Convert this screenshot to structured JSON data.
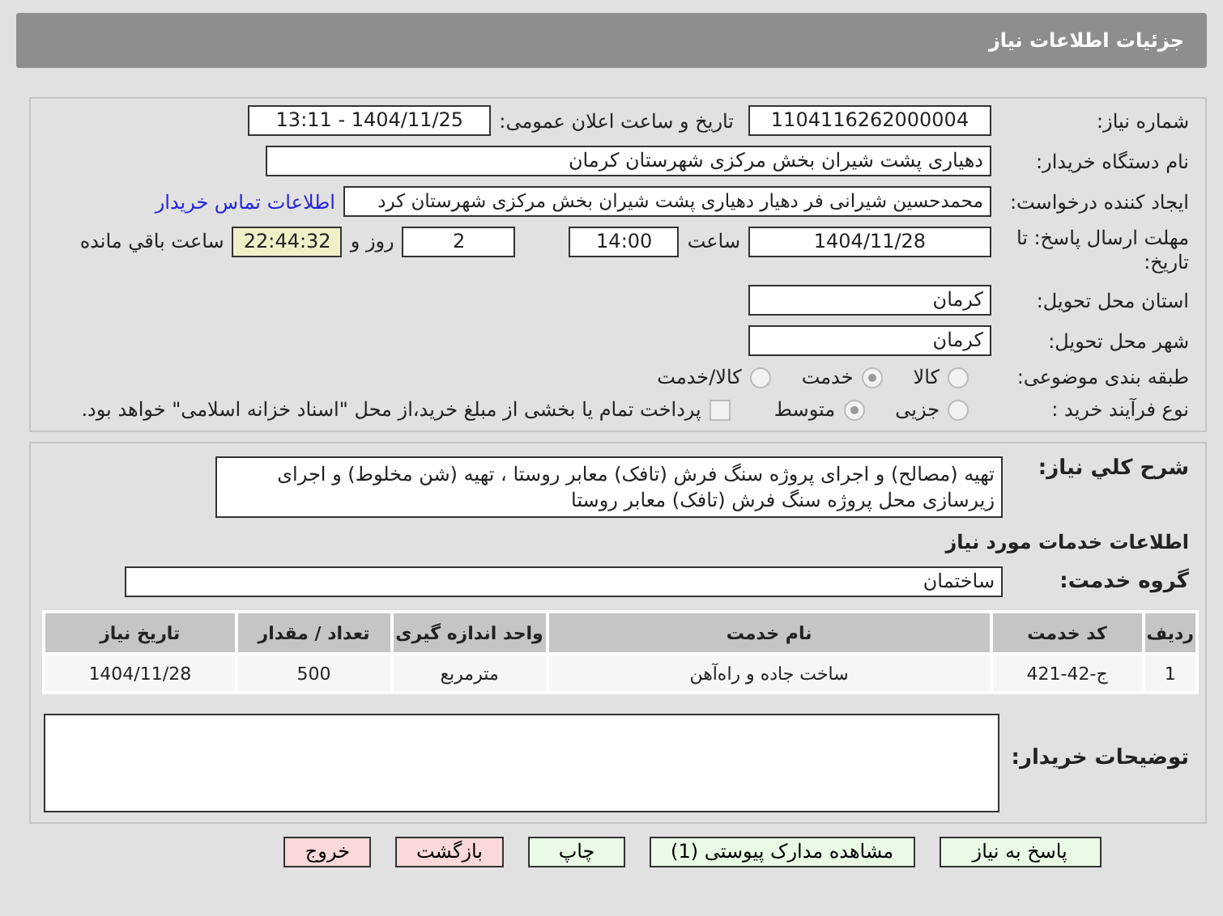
{
  "header": {
    "title": "جزئیات اطلاعات نیاز"
  },
  "details": {
    "need_number": {
      "label": "شماره نیاز:",
      "value": "1104116262000004"
    },
    "announce": {
      "label": "تاریخ و ساعت اعلان عمومی:",
      "value": "1404/11/25 - 13:11"
    },
    "buyer": {
      "label": "نام دستگاه خریدار:",
      "value": "دهیاری پشت شیران بخش مرکزی شهرستان کرمان"
    },
    "creator": {
      "label": "ایجاد کننده درخواست:",
      "value": "محمدحسین شیرانی فر دهیار دهیاری پشت شیران بخش مرکزی شهرستان کرد",
      "link": "اطلاعات تماس خریدار"
    },
    "deadline": {
      "label": "مهلت ارسال پاسخ: تا تاریخ:",
      "date": "1404/11/28",
      "time_label": "ساعت",
      "time": "14:00",
      "days": "2",
      "days_label": "روز و",
      "remaining": "22:44:32",
      "remaining_label": "ساعت باقي مانده"
    },
    "province": {
      "label": "استان محل تحویل:",
      "value": "کرمان"
    },
    "city": {
      "label": "شهر محل تحویل:",
      "value": "کرمان"
    },
    "category": {
      "label": "طبقه بندی موضوعی:",
      "options": [
        {
          "label": "کالا",
          "selected": false
        },
        {
          "label": "خدمت",
          "selected": true
        },
        {
          "label": "کالا/خدمت",
          "selected": false
        }
      ]
    },
    "process": {
      "label": "نوع فرآیند خرید :",
      "options": [
        {
          "label": "جزیی",
          "selected": false
        },
        {
          "label": "متوسط",
          "selected": true
        }
      ],
      "checkbox": {
        "checked": false,
        "label": "پرداخت تمام یا بخشی از مبلغ خرید،از محل \"اسناد خزانه اسلامی\" خواهد بود."
      }
    }
  },
  "description": {
    "label": "شرح کلي نياز:",
    "value": "تهیه (مصالح) و اجرای پروژه سنگ فرش (تافک) معابر روستا ، تهیه (شن مخلوط) و اجرای زیرسازی محل پروژه سنگ فرش (تافک) معابر روستا"
  },
  "services_title": "اطلاعات خدمات مورد نیاز",
  "service_group": {
    "label": "گروه خدمت:",
    "value": "ساختمان"
  },
  "table": {
    "columns": [
      "ردیف",
      "کد خدمت",
      "نام خدمت",
      "واحد اندازه گیری",
      "تعداد / مقدار",
      "تاریخ نیاز"
    ],
    "rows": [
      [
        "1",
        "ج-42-421",
        "ساخت جاده و راه‌آهن",
        "مترمربع",
        "500",
        "1404/11/28"
      ]
    ]
  },
  "buyer_notes": {
    "label": "توضیحات خریدار:"
  },
  "buttons": [
    {
      "label": "پاسخ به نیاز",
      "kind": "normal"
    },
    {
      "label": "مشاهده مدارک پیوستی (1)",
      "kind": "normal"
    },
    {
      "label": "چاپ",
      "kind": "normal"
    },
    {
      "label": "بازگشت",
      "kind": "exit"
    },
    {
      "label": "خروج",
      "kind": "exit"
    }
  ]
}
